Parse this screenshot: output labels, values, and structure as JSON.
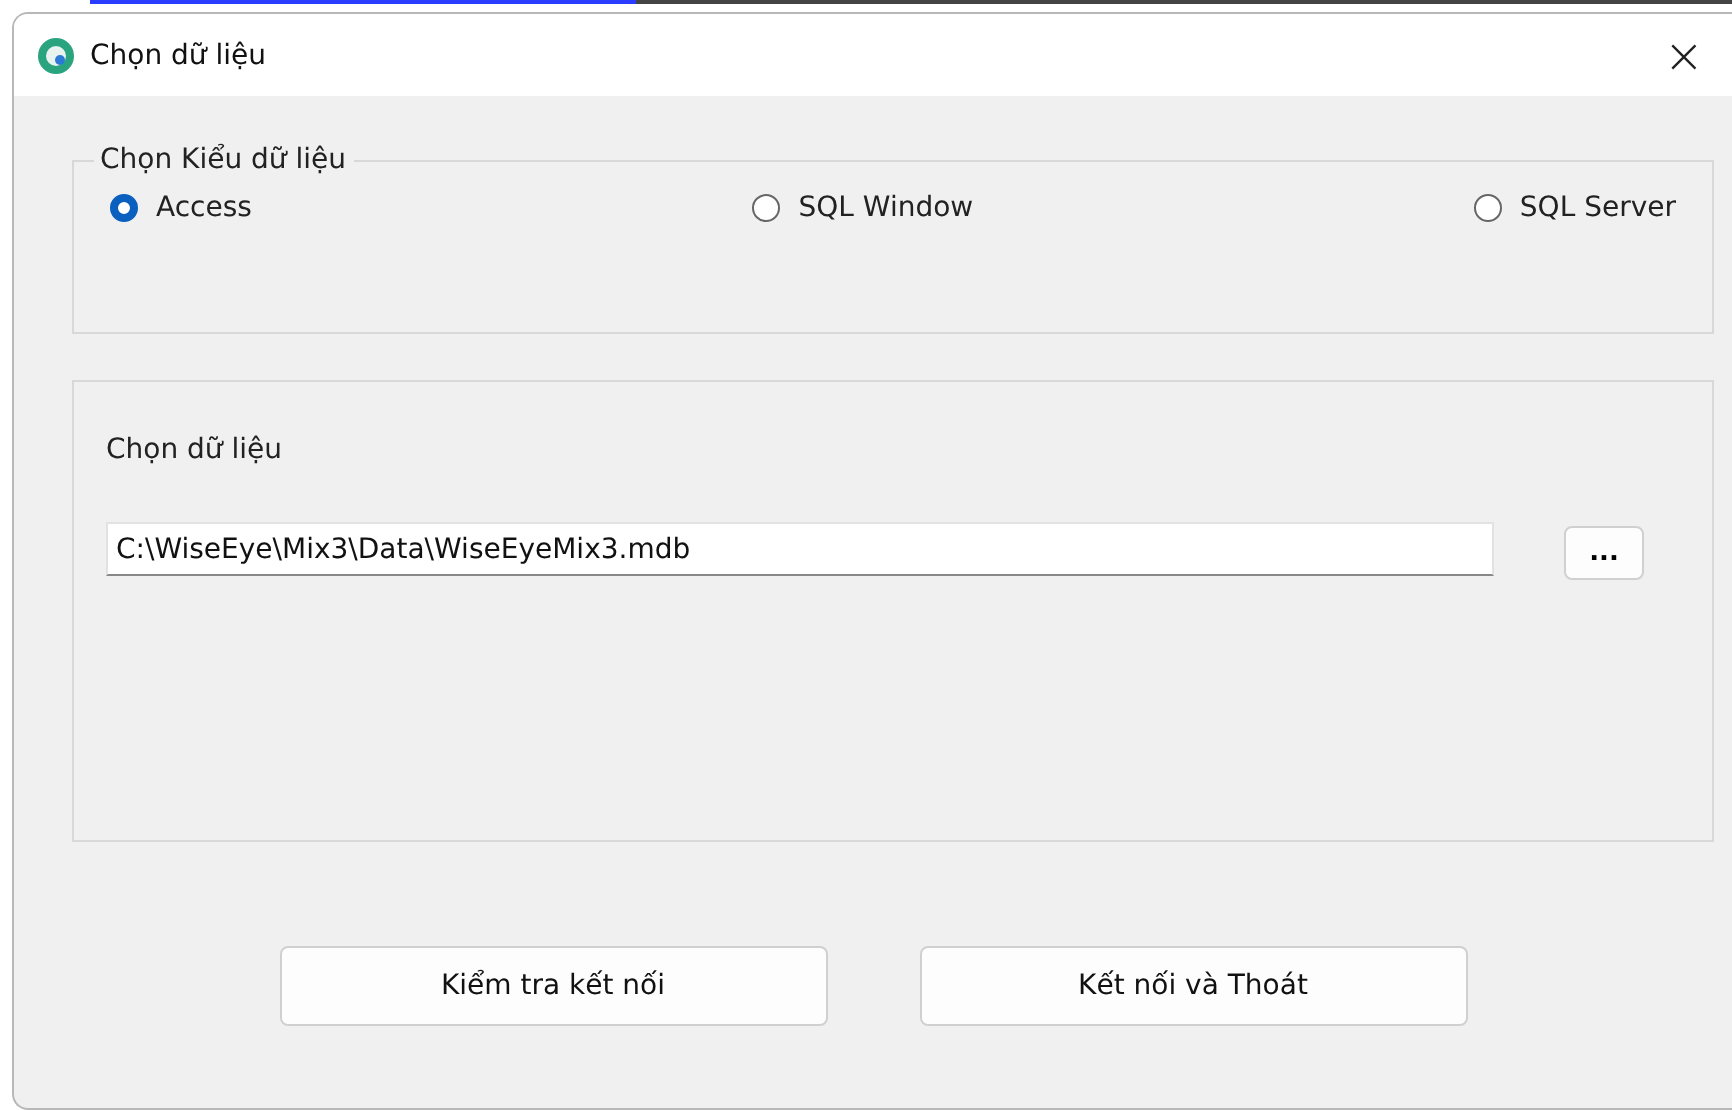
{
  "window": {
    "title": "Chọn dữ liệu",
    "close": "×"
  },
  "type_group": {
    "legend": "Chọn Kiểu dữ liệu",
    "options": [
      {
        "label": "Access",
        "selected": true
      },
      {
        "label": "SQL Window",
        "selected": false
      },
      {
        "label": "SQL Server",
        "selected": false
      }
    ]
  },
  "data_group": {
    "label": "Chọn dữ liệu",
    "path": "C:\\WiseEye\\Mix3\\Data\\WiseEyeMix3.mdb",
    "browse": "..."
  },
  "buttons": [
    "Kiểm tra kết nối",
    "Kết nối và Thoát"
  ]
}
